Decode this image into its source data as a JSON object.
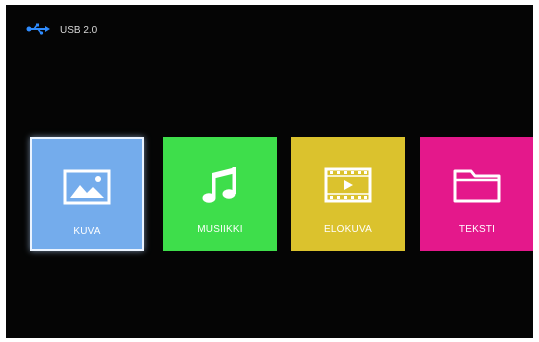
{
  "status_bar": {
    "source_icon": "usb-icon",
    "source_label": "USB 2.0"
  },
  "menu": {
    "tiles": [
      {
        "label": "KUVA",
        "icon": "image-icon",
        "color": "#74acec",
        "selected": true
      },
      {
        "label": "MUSIIKKI",
        "icon": "music-note-icon",
        "color": "#3ede4b",
        "selected": false
      },
      {
        "label": "ELOKUVA",
        "icon": "film-icon",
        "color": "#dbc22d",
        "selected": false
      },
      {
        "label": "TEKSTI",
        "icon": "folder-icon",
        "color": "#e4188b",
        "selected": false
      }
    ]
  }
}
